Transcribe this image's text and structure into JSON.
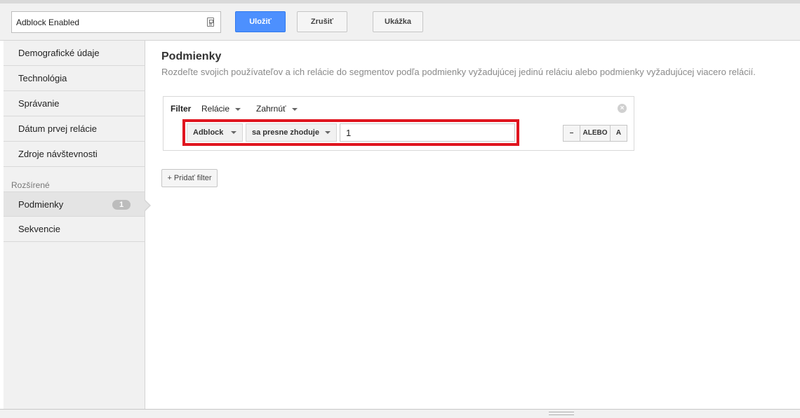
{
  "header": {
    "segment_name": "Adblock Enabled",
    "save_label": "Uložiť",
    "cancel_label": "Zrušiť",
    "preview_label": "Ukážka"
  },
  "sidebar": {
    "items": [
      {
        "label": "Demografické údaje"
      },
      {
        "label": "Technológia"
      },
      {
        "label": "Správanie"
      },
      {
        "label": "Dátum prvej relácie"
      },
      {
        "label": "Zdroje návštevnosti"
      }
    ],
    "advanced_label": "Rozšírené",
    "advanced_items": [
      {
        "label": "Podmienky",
        "badge": "1"
      },
      {
        "label": "Sekvencie"
      }
    ]
  },
  "main": {
    "title": "Podmienky",
    "description": "Rozdeľte svojich používateľov a ich relácie do segmentov podľa podmienky vyžadujúcej jedinú reláciu alebo podmienky vyžadujúcej viacero relácií.",
    "filter": {
      "label": "Filter",
      "scope": "Relácie",
      "mode": "Zahrnúť",
      "condition": {
        "dimension": "Adblock",
        "match_type": "sa presne zhoduje",
        "value": "1"
      },
      "ops": {
        "minus": "–",
        "or": "ALEBO",
        "and": "A"
      }
    },
    "add_filter_label": "+ Pridať filter"
  },
  "colors": {
    "primary_button": "#4d90fe",
    "highlight_border": "#e0151f",
    "sidebar_bg": "#f1f1f1"
  }
}
